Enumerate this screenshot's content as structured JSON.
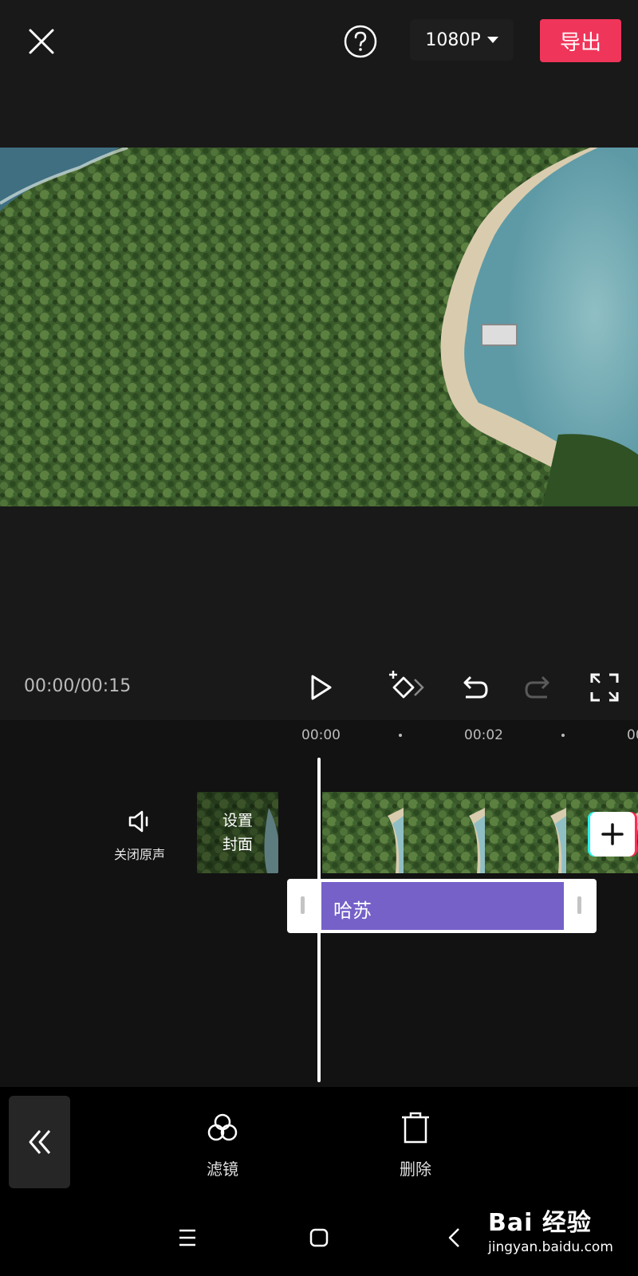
{
  "header": {
    "resolution_label": "1080P",
    "export_label": "导出"
  },
  "playback": {
    "timecode": "00:00/00:15"
  },
  "timeline": {
    "ruler_labels": [
      "00:00",
      "00:02",
      "00"
    ],
    "mute_label": "关闭原声",
    "cover_label_line1": "设置",
    "cover_label_line2": "封面",
    "text_clip_label": "哈苏"
  },
  "toolbar": {
    "filter_label": "滤镜",
    "delete_label": "删除"
  },
  "watermark": {
    "brand": "Bai 经验",
    "url": "jingyan.baidu.com"
  },
  "colors": {
    "accent": "#f0355a",
    "text_clip": "#7561c8"
  }
}
